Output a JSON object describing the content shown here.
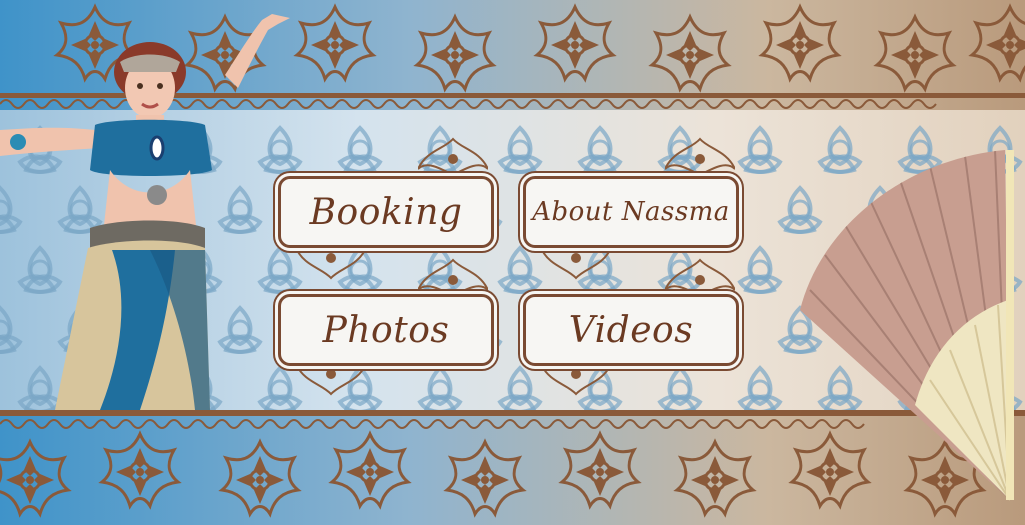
{
  "nav": {
    "booking_label": "Booking",
    "about_label": "About Nassma",
    "photos_label": "Photos",
    "videos_label": "Videos"
  },
  "colors": {
    "henna_brown": "#8a5a3a",
    "button_border": "#7a4a32",
    "button_text": "#6b3a22",
    "accent_blue": "#3f93c9",
    "fan_pink": "#c89e90"
  },
  "icons": {
    "ornament": "henna-flower-icon"
  }
}
